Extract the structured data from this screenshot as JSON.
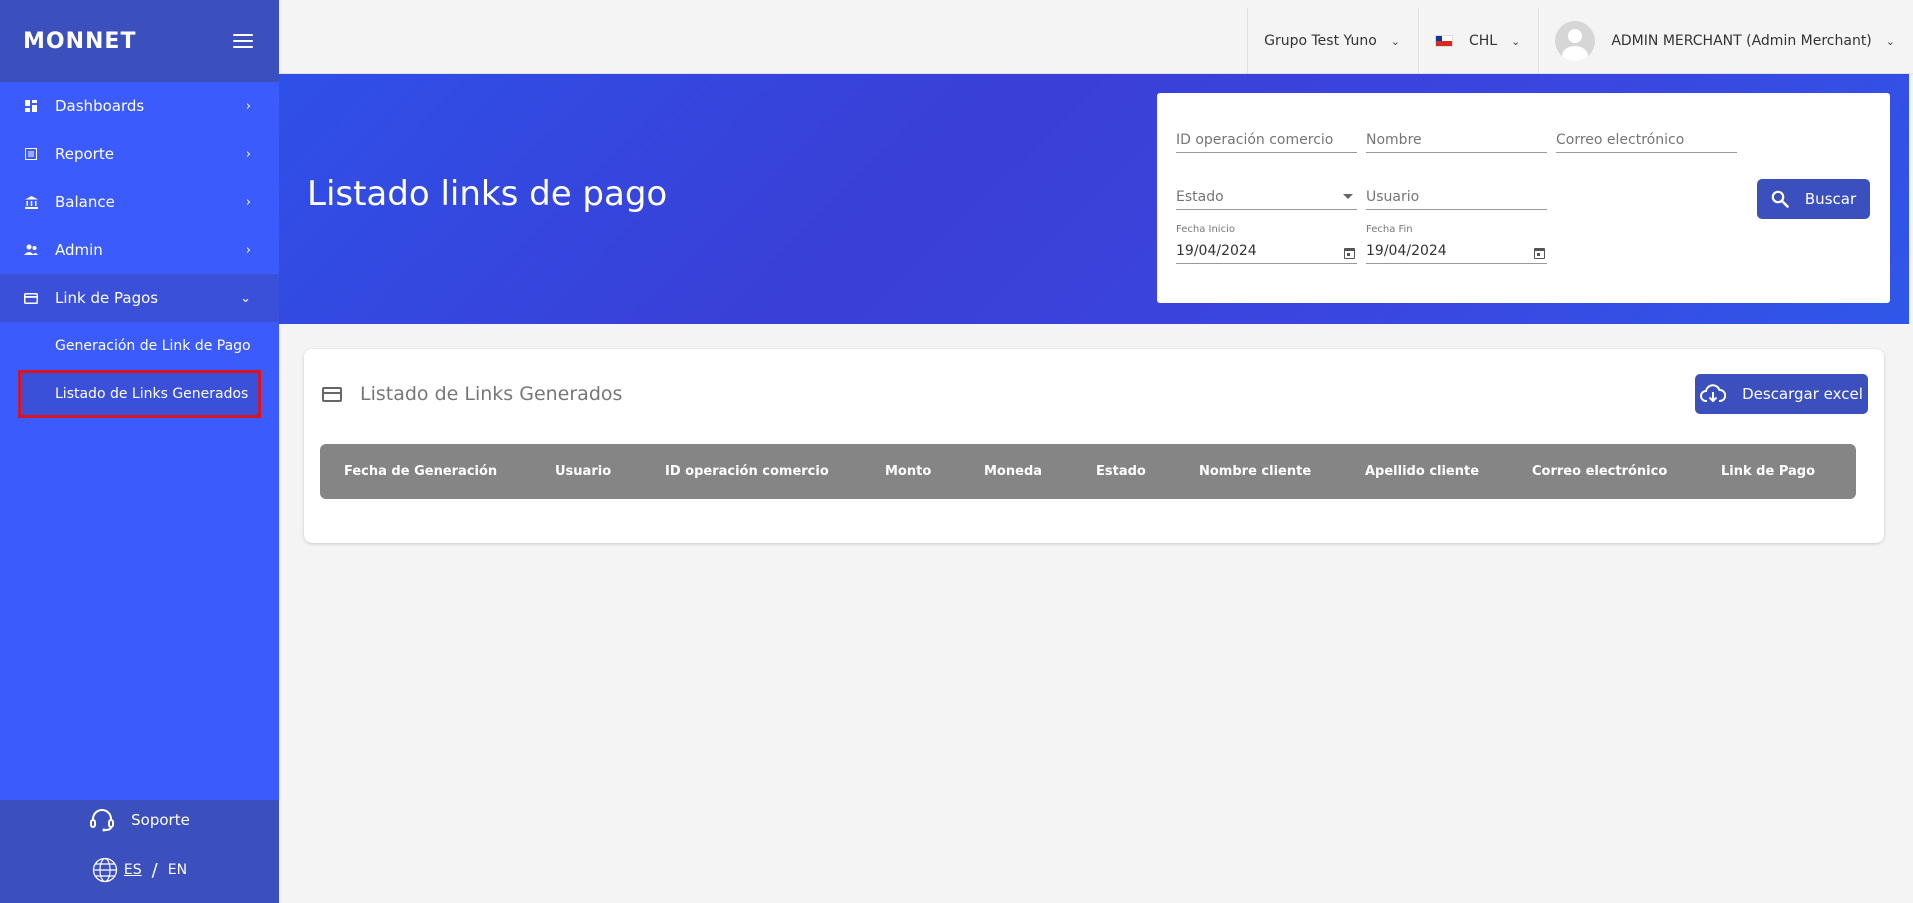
{
  "sidebar": {
    "logo": "MONNET",
    "items": [
      {
        "label": "Dashboards",
        "icon": "dashboard-icon"
      },
      {
        "label": "Reporte",
        "icon": "report-icon"
      },
      {
        "label": "Balance",
        "icon": "bank-icon"
      },
      {
        "label": "Admin",
        "icon": "users-icon"
      },
      {
        "label": "Link de Pagos",
        "icon": "card-icon"
      }
    ],
    "subitems": [
      {
        "label": "Generación de Link de Pago"
      },
      {
        "label": "Listado de Links Generados"
      }
    ],
    "footer": {
      "support": "Soporte",
      "lang_es": "ES",
      "lang_sep": "/",
      "lang_en": "EN"
    }
  },
  "topbar": {
    "group": "Grupo Test Yuno",
    "currency": "CHL",
    "user": "ADMIN MERCHANT (Admin Merchant)"
  },
  "banner": {
    "title": "Listado links de pago"
  },
  "filters": {
    "id_op": {
      "placeholder": "ID operación comercio"
    },
    "nombre": {
      "placeholder": "Nombre"
    },
    "correo": {
      "placeholder": "Correo electrónico"
    },
    "estado": {
      "placeholder": "Estado"
    },
    "usuario": {
      "placeholder": "Usuario"
    },
    "fecha_inicio": {
      "label": "Fecha Inicio",
      "value": "19/04/2024"
    },
    "fecha_fin": {
      "label": "Fecha Fin",
      "value": "19/04/2024"
    },
    "search_button": "Buscar"
  },
  "table": {
    "title": "Listado de Links Generados",
    "download_button": "Descargar excel",
    "columns": [
      "Fecha de Generación",
      "Usuario",
      "ID operación comercio",
      "Monto",
      "Moneda",
      "Estado",
      "Nombre cliente",
      "Apellido cliente",
      "Correo electrónico",
      "Link de Pago"
    ],
    "rows": []
  },
  "colors": {
    "sidebar": "#3b5bfd",
    "sidebar_dark": "#3b4fbd",
    "button": "#3b4fbd",
    "highlight_outline": "#d9141e",
    "table_header": "#858585"
  }
}
